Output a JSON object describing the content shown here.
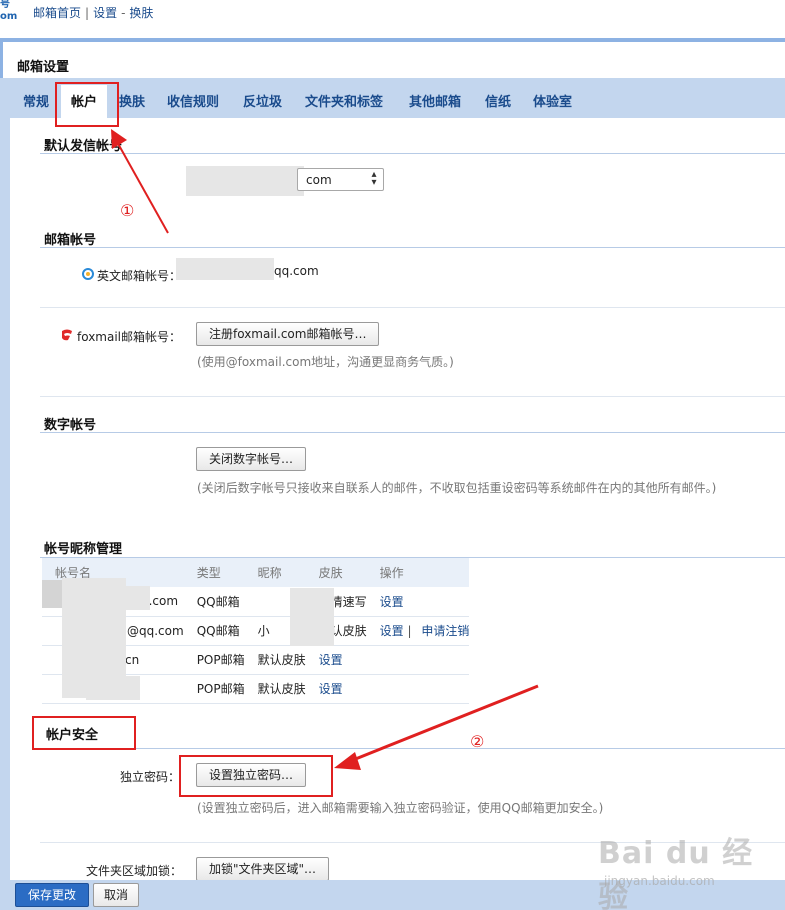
{
  "breadcrumb": {
    "home": "邮箱首页",
    "settings": "设置",
    "current": "换肤",
    "separator": "|",
    "dash": "-"
  },
  "logo": {
    "line1": "号",
    "line2": "om"
  },
  "page_title": "邮箱设置",
  "tabs": [
    {
      "label": "常规"
    },
    {
      "label": "帐户"
    },
    {
      "label": "换肤"
    },
    {
      "label": "收信规则"
    },
    {
      "label": "反垃圾"
    },
    {
      "label": "文件夹和标签"
    },
    {
      "label": "其他邮箱"
    },
    {
      "label": "信纸"
    },
    {
      "label": "体验室"
    }
  ],
  "sections": {
    "default_sender": {
      "title": "默认发信帐号",
      "select_value": "com",
      "select_arrows": "▴▾"
    },
    "mailbox_account": {
      "title": "邮箱帐号",
      "english_label": "英文邮箱帐号：",
      "english_value": "qq.com",
      "foxmail_label": "foxmail邮箱帐号：",
      "foxmail_button": "注册foxmail.com邮箱帐号…",
      "foxmail_hint": "(使用@foxmail.com地址，沟通更显商务气质。)"
    },
    "digital_account": {
      "title": "数字帐号",
      "button": "关闭数字帐号…",
      "hint": "(关闭后数字帐号只接收来自联系人的邮件，不收取包括重设密码等系统邮件在内的其他所有邮件。)"
    },
    "nickname_mgmt": {
      "title": "帐号昵称管理",
      "columns": [
        "帐号名",
        "类型",
        "昵称",
        "皮肤",
        "操作"
      ],
      "rows": [
        {
          "account": "q.com",
          "type": "QQ邮箱",
          "nickname": "",
          "skin": "心情速写",
          "actions": [
            "设置"
          ]
        },
        {
          "account": "@qq.com",
          "type": "QQ邮箱",
          "nickname": "小",
          "skin": "默认皮肤",
          "actions": [
            "设置",
            "申请注销"
          ],
          "action_sep": "|"
        },
        {
          "account": "cn",
          "type": "POP邮箱",
          "nickname": "默认皮肤",
          "skin": "",
          "actions": [
            "设置"
          ]
        },
        {
          "account": "cn",
          "type": "POP邮箱",
          "nickname": "默认皮肤",
          "skin": "",
          "actions": [
            "设置"
          ]
        }
      ]
    },
    "account_security": {
      "title": "帐户安全",
      "pwd_label": "独立密码：",
      "pwd_button": "设置独立密码…",
      "pwd_hint": "(设置独立密码后，进入邮箱需要输入独立密码验证，使用QQ邮箱更加安全。)",
      "folder_lock_label": "文件夹区域加锁：",
      "folder_lock_button": "加锁\"文件夹区域\"…"
    }
  },
  "annotations": {
    "step1": "①",
    "step2": "②",
    "color": "#e02020"
  },
  "footer": {
    "save": "保存更改",
    "cancel": "取消"
  },
  "watermark": {
    "brand": "Bai du 经验",
    "url": "jingyan.baidu.com"
  },
  "colors": {
    "tab_bar": "#c3d6ee",
    "accent": "#2b6cc4",
    "link": "#1a4b8c",
    "annotation": "#e02020"
  }
}
